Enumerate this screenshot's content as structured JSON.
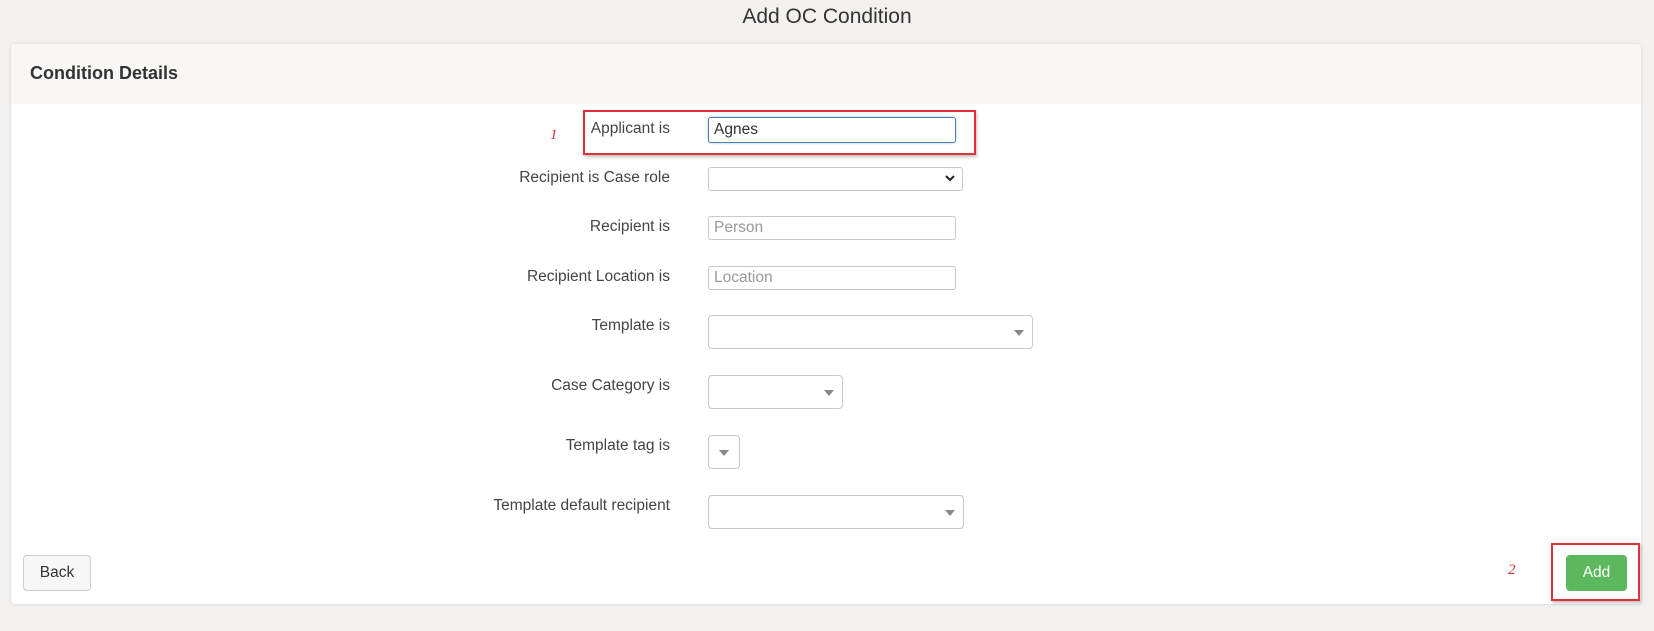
{
  "page": {
    "title": "Add OC Condition"
  },
  "panel": {
    "header_title": "Condition Details"
  },
  "form": {
    "applicant": {
      "label": "Applicant is",
      "value": "Agnes"
    },
    "recipient_case_role": {
      "label": "Recipient is Case role",
      "selected": ""
    },
    "recipient": {
      "label": "Recipient is",
      "placeholder": "Person",
      "value": ""
    },
    "recipient_location": {
      "label": "Recipient Location is",
      "placeholder": "Location",
      "value": ""
    },
    "template": {
      "label": "Template is",
      "selected": ""
    },
    "case_category": {
      "label": "Case Category is",
      "selected": ""
    },
    "template_tag": {
      "label": "Template tag is",
      "selected": ""
    },
    "template_default_recipient": {
      "label": "Template default recipient",
      "selected": ""
    }
  },
  "buttons": {
    "back_label": "Back",
    "add_label": "Add"
  },
  "annotations": {
    "marker_1": "1",
    "marker_2": "2",
    "color": "#e0303a"
  },
  "colors": {
    "page_background": "#f3f1ef",
    "add_button": "#5cb85c",
    "focus_border": "#4a7fb0"
  },
  "icons": {
    "recipient_case_role_dropdown": "chevron-down-icon",
    "combo_dropdown": "caret-down-icon"
  }
}
